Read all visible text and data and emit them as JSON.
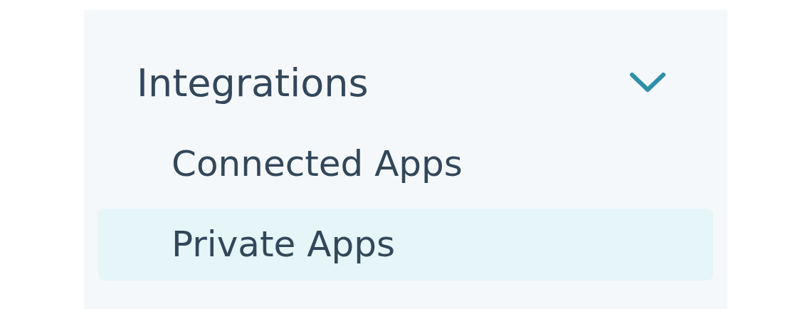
{
  "section": {
    "label": "Integrations",
    "expanded": true
  },
  "items": [
    {
      "label": "Connected Apps",
      "selected": false
    },
    {
      "label": "Private Apps",
      "selected": true
    }
  ]
}
